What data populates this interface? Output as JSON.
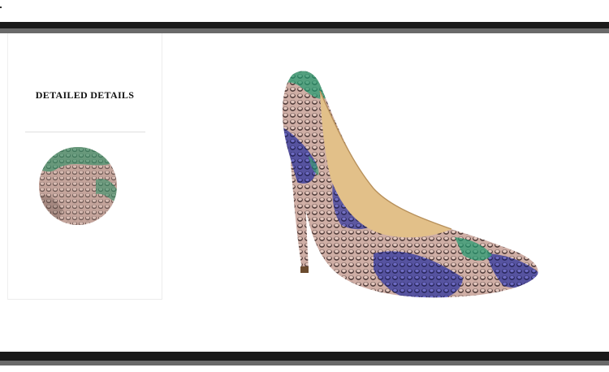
{
  "detail_panel": {
    "title": "DETAILED DETAILS"
  },
  "colors": {
    "bar_dark": "#1a1a1a",
    "bar_strip": "#6a6a6a",
    "snake_pink": "#c9aaa2",
    "snake_blue": "#3a3fa6",
    "snake_green": "#1f9a6e",
    "lining": "#e2c089"
  },
  "images": {
    "zoom": "snakeskin-texture-closeup",
    "product": "snakeskin-pointed-toe-stiletto-pump"
  }
}
